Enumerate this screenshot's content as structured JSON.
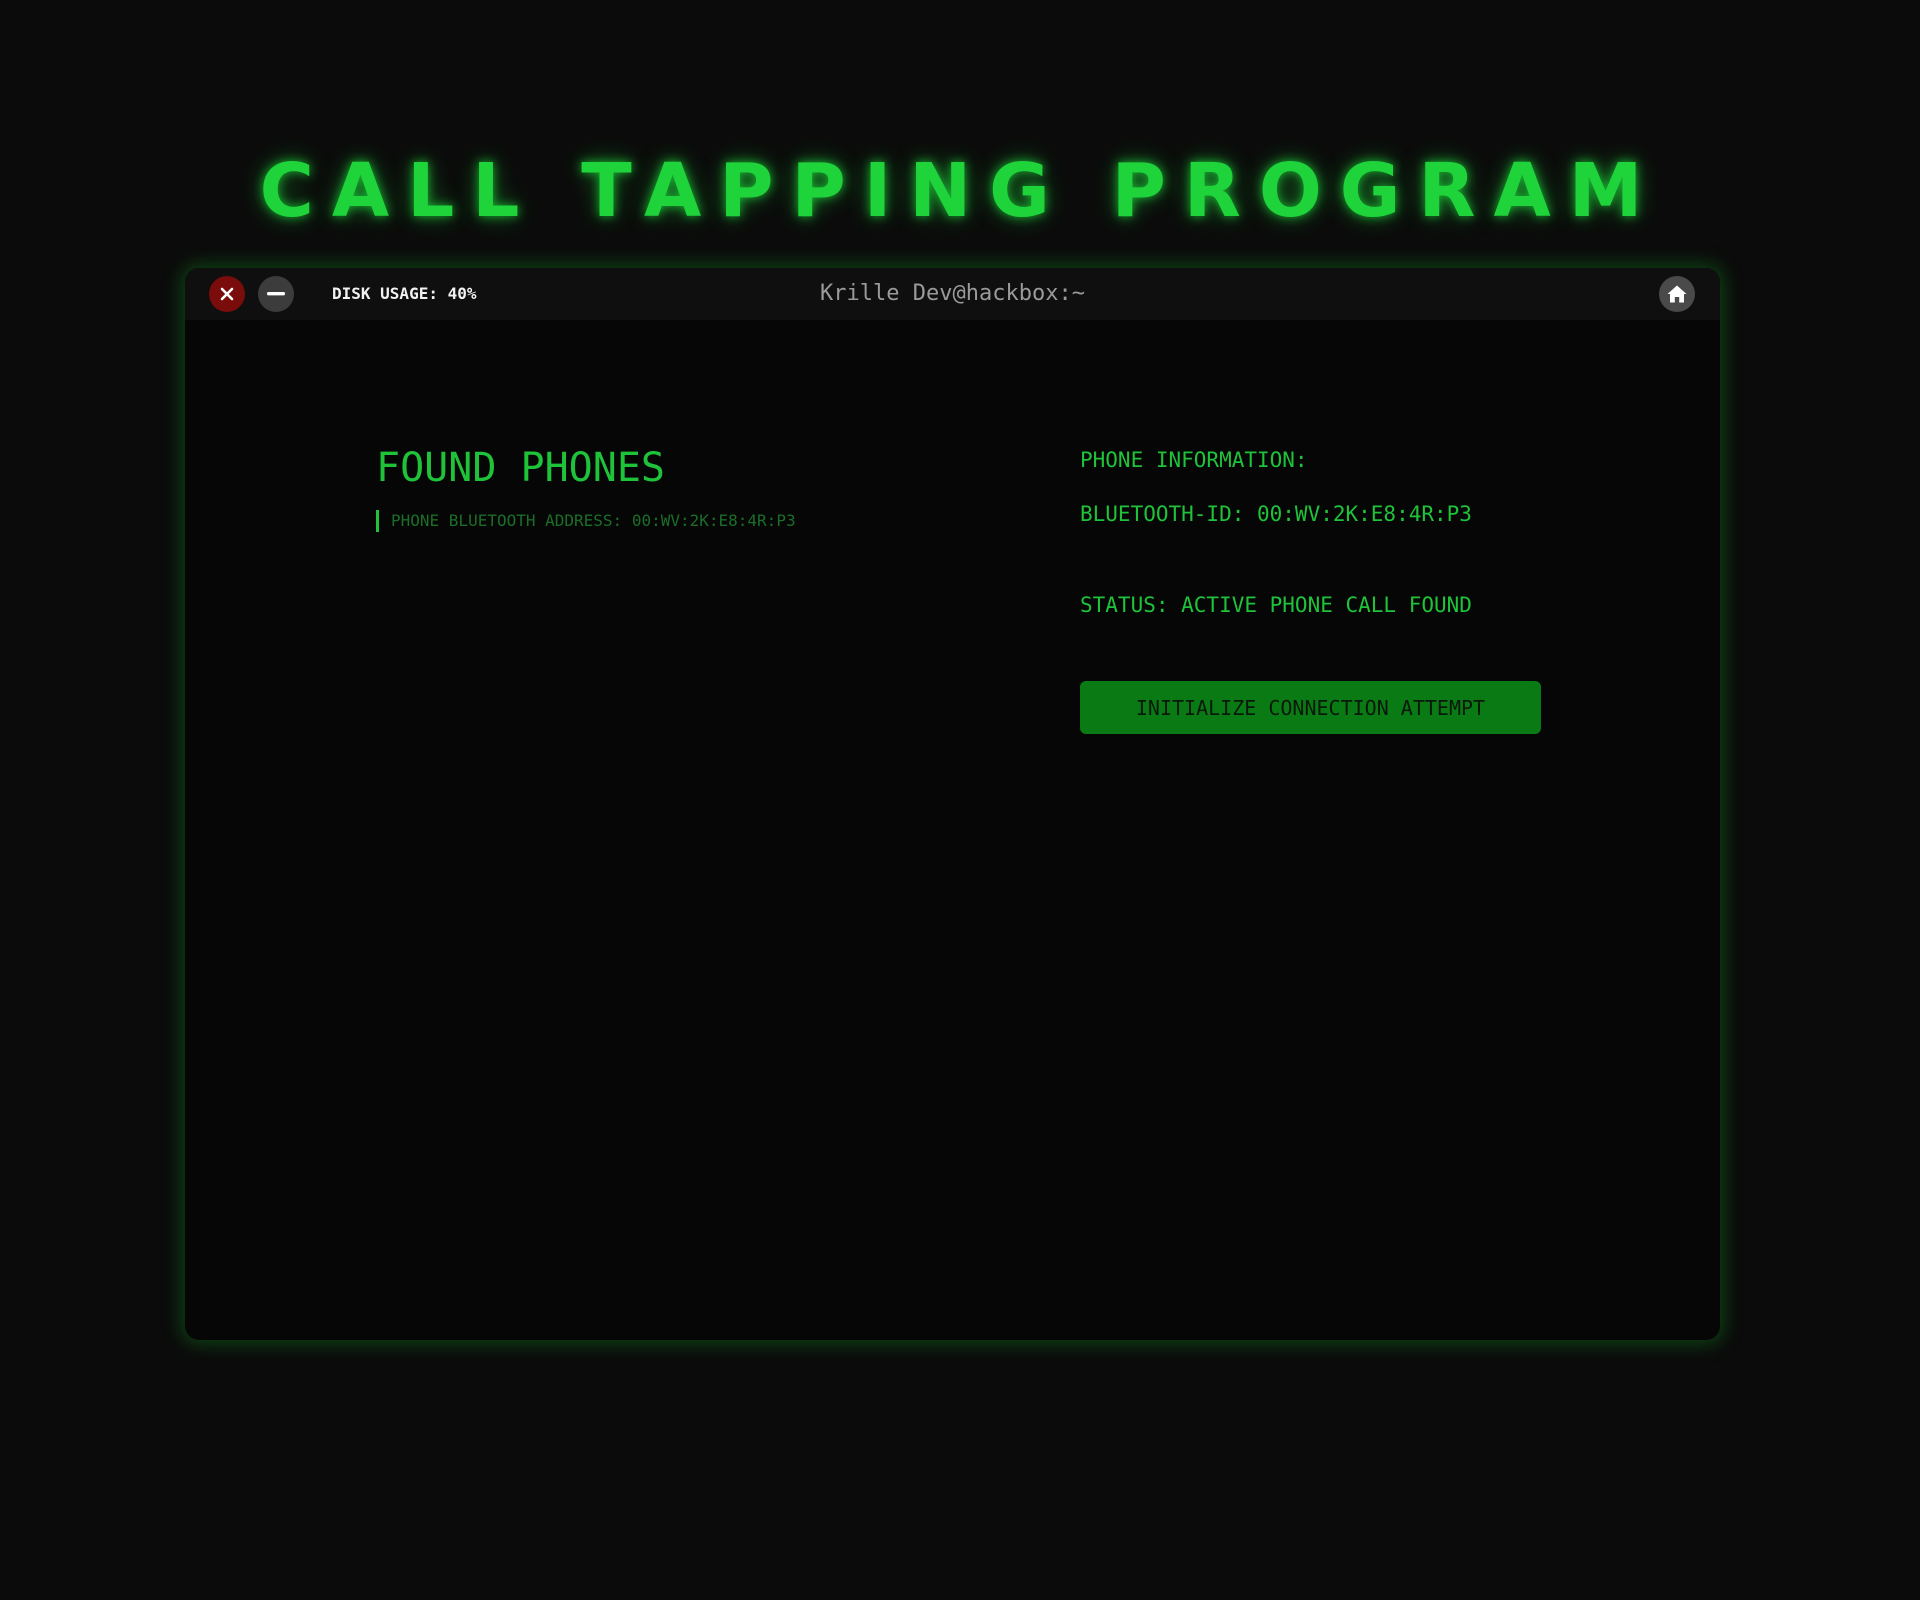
{
  "page": {
    "title": "CALL TAPPING PROGRAM"
  },
  "window": {
    "title": "Krille Dev@hackbox:~",
    "disk_usage": "DISK USAGE: 40%",
    "buttons": {
      "close_icon": "close-icon",
      "minimize_icon": "minimize-icon",
      "home_icon": "home-icon"
    }
  },
  "found_phones": {
    "heading": "FOUND PHONES",
    "items": [
      {
        "label": "PHONE BLUETOOTH ADDRESS: 00:WV:2K:E8:4R:P3"
      }
    ]
  },
  "phone_information": {
    "label": "PHONE INFORMATION:",
    "bluetooth_id": "BLUETOOTH-ID: 00:WV:2K:E8:4R:P3",
    "status": "STATUS: ACTIVE PHONE CALL FOUND",
    "connect_button_label": "INITIALIZE CONNECTION ATTEMPT"
  },
  "colors": {
    "accent_green": "#1fc33a",
    "title_green": "#1ed43a",
    "button_green": "#0a7a14",
    "close_red": "#7a0c0c",
    "background": "#0b0b0b"
  }
}
